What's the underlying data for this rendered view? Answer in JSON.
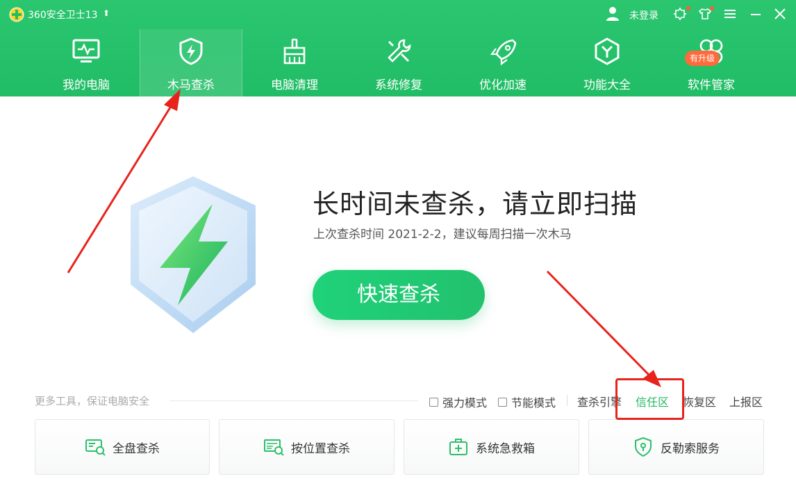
{
  "app": {
    "title": "360安全卫士13",
    "login_text": "未登录"
  },
  "nav": {
    "items": [
      {
        "label": "我的电脑",
        "icon": "monitor-icon"
      },
      {
        "label": "木马查杀",
        "icon": "shield-icon",
        "active": true
      },
      {
        "label": "电脑清理",
        "icon": "broom-icon"
      },
      {
        "label": "系统修复",
        "icon": "wrench-icon"
      },
      {
        "label": "优化加速",
        "icon": "rocket-icon"
      },
      {
        "label": "功能大全",
        "icon": "hexagon-icon"
      },
      {
        "label": "软件管家",
        "icon": "clover-icon"
      }
    ],
    "upgrade_badge": "有升级"
  },
  "main": {
    "headline": "长时间未查杀，请立即扫描",
    "subline": "上次查杀时间 2021-2-2，建议每周扫描一次木马",
    "scan_button": "快速查杀"
  },
  "tools": {
    "caption": "更多工具，保证电脑安全",
    "options": [
      {
        "label": "强力模式",
        "checked": false
      },
      {
        "label": "节能模式",
        "checked": false
      }
    ],
    "links": [
      "查杀引擎",
      "信任区",
      "恢复区",
      "上报区"
    ],
    "cards": [
      {
        "label": "全盘查杀",
        "icon": "disk-scan-icon"
      },
      {
        "label": "按位置查杀",
        "icon": "location-scan-icon"
      },
      {
        "label": "系统急救箱",
        "icon": "first-aid-kit-icon"
      },
      {
        "label": "反勒索服务",
        "icon": "lock-shield-icon"
      }
    ]
  },
  "colors": {
    "brand_green": "#21bd66",
    "highlight_red": "#e8231c",
    "link_green": "#1fb85e",
    "badge_orange": "#ff6a3c"
  }
}
